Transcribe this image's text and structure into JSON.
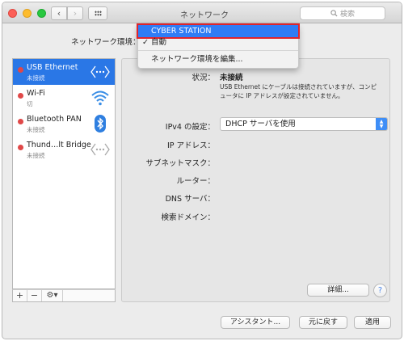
{
  "window": {
    "title": "ネットワーク"
  },
  "toolbar": {
    "back": "‹",
    "forward": "›",
    "search_placeholder": "検索"
  },
  "location": {
    "label": "ネットワーク環境：",
    "menu": {
      "highlighted": "CYBER STATION",
      "checked": "自動",
      "check_mark": "✓",
      "edit": "ネットワーク環境を編集..."
    }
  },
  "services": [
    {
      "name": "USB Ethernet",
      "status": "未接続",
      "icon": "ethernet-icon",
      "active": true
    },
    {
      "name": "Wi-Fi",
      "status": "切",
      "icon": "wifi-icon",
      "active": false
    },
    {
      "name": "Bluetooth PAN",
      "status": "未接続",
      "icon": "bluetooth-icon",
      "active": false
    },
    {
      "name": "Thund…lt Bridge",
      "status": "未接続",
      "icon": "thunderbolt-bridge-icon",
      "active": false
    }
  ],
  "sidebar_footer": {
    "add": "+",
    "remove": "−",
    "gear": "⚙▾"
  },
  "detail": {
    "status_label": "状況：",
    "status_value": "未接続",
    "status_description": "USB Ethernet にケーブルは接続されていますが、コンピュータに IP アドレスが設定されていません。",
    "ipv4_label": "IPv4 の設定：",
    "ipv4_value": "DHCP サーバを使用",
    "ip_address_label": "IP アドレス：",
    "subnet_label": "サブネットマスク：",
    "router_label": "ルーター：",
    "dns_label": "DNS サーバ：",
    "search_domain_label": "検索ドメイン：",
    "advanced_button": "詳細...",
    "help": "?"
  },
  "footer": {
    "assistant": "アシスタント...",
    "revert": "元に戻す",
    "apply": "適用"
  },
  "colors": {
    "selection": "#2a77e6",
    "menu_highlight": "#2f7cf5",
    "highlight_box": "#e0242b",
    "status_dot": "#e04848"
  }
}
